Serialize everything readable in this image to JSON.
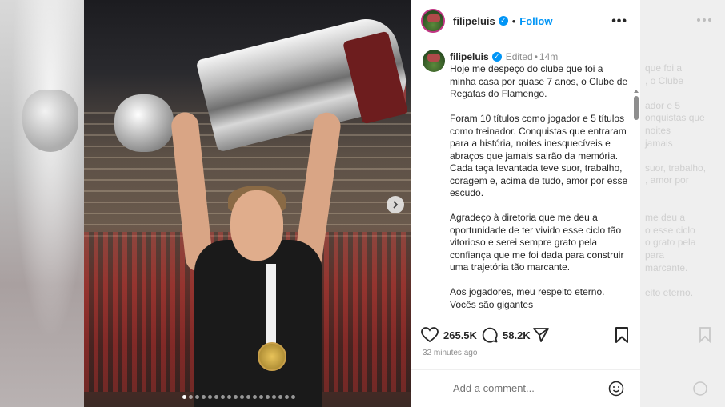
{
  "post": {
    "username": "filipeluis",
    "separator": "•",
    "follow_label": "Follow",
    "more_label": "•••",
    "edited_label": "Edited",
    "dot": "•",
    "time_ago": "14m",
    "caption": "Hoje me despeço do clube que foi a minha casa por quase 7 anos, o Clube de Regatas do Flamengo.\n\nForam 10 títulos como jogador e 5 títulos como treinador. Conquistas que entraram para a história, noites inesquecíveis e abraços que jamais sairão da memória.\nCada taça levantada teve suor, trabalho, coragem e, acima de tudo, amor por esse escudo.\n\nAgradeço à diretoria que me deu a oportunidade de ter vivido esse ciclo tão vitorioso e serei sempre grato pela confiança que me foi dada para construir uma trajetória tão marcante.\n\nAos jogadores, meu respeito eterno.\nVocês são gigantes",
    "likes": "265.5K",
    "comments": "58.2K",
    "timestamp": "32 minutes ago",
    "comment_placeholder": "Add a comment..."
  },
  "ghost_text": "que foi a\n, o Clube\n\nador e 5\nonquistas que\nnoites\njamais\n\nsuor, trabalho,\n, amor por\n\n\nme deu a\no esse ciclo\no grato pela\npara\nmarcante.\n\neito eterno.",
  "carousel": {
    "total": 18,
    "active": 0
  },
  "colors": {
    "accent": "#0095f6",
    "verified": "#0095f6",
    "text": "#262626",
    "muted": "#8e8e8e"
  },
  "icons": [
    "verified-icon",
    "more-icon",
    "heart-icon",
    "comment-icon",
    "share-icon",
    "bookmark-icon",
    "emoji-icon",
    "chevron-right-icon"
  ]
}
